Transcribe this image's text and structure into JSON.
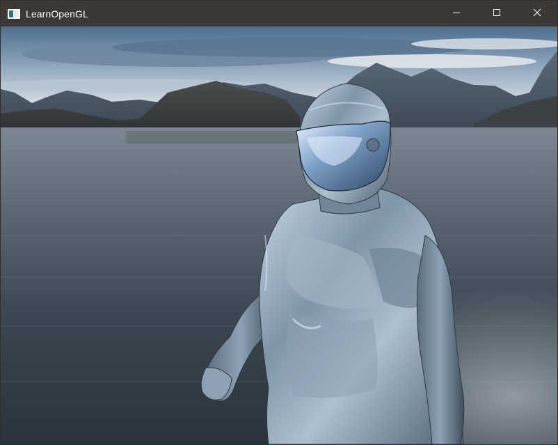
{
  "window": {
    "title": "LearnOpenGL",
    "controls": [
      "minimize-icon",
      "maximize-icon",
      "close-icon"
    ]
  },
  "scene": {
    "description_icon": "app-window-icon",
    "colors": {
      "titlebar": "#3b3836",
      "sky_top": "#4f6f8f",
      "water": "#2f3a45",
      "chrome": "#9fb3c6"
    }
  }
}
